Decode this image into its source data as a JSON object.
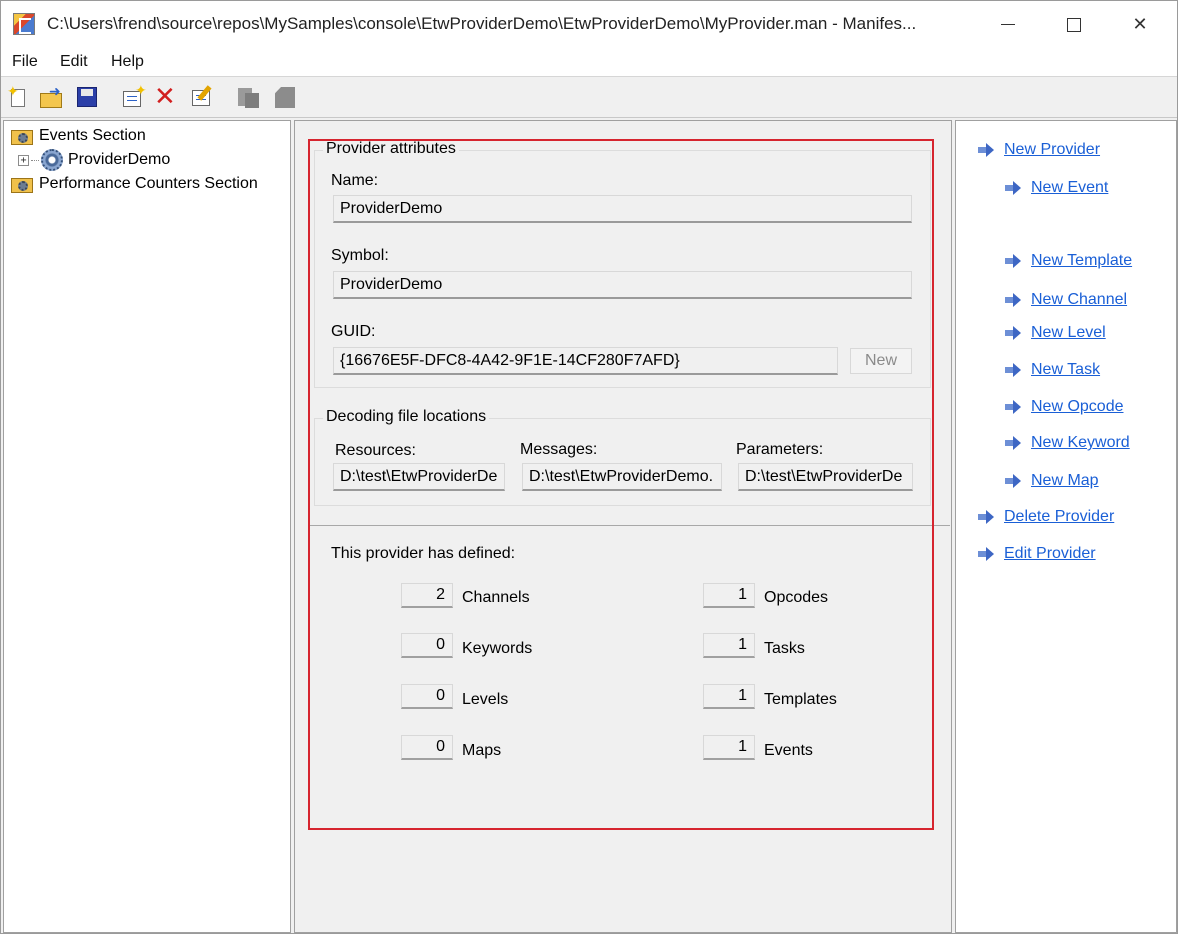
{
  "window": {
    "title": "C:\\Users\\frend\\source\\repos\\MySamples\\console\\EtwProviderDemo\\EtwProviderDemo\\MyProvider.man - Manifes...",
    "minimize_icon": "minimize-icon",
    "maximize_icon": "maximize-icon",
    "close_glyph": "✕"
  },
  "menu": {
    "items": [
      "File",
      "Edit",
      "Help"
    ]
  },
  "toolbar": {
    "icons": [
      "new-file-icon",
      "open-folder-icon",
      "save-icon",
      "new-item-icon",
      "delete-icon",
      "edit-icon",
      "copy-icon",
      "paste-icon"
    ],
    "delete_glyph": "✕",
    "star_glyph": "✦"
  },
  "tree": {
    "items": [
      {
        "label": "Events Section",
        "icon": "folder-gear-icon"
      },
      {
        "label": "ProviderDemo",
        "icon": "gear-icon",
        "expander": "+"
      },
      {
        "label": "Performance Counters Section",
        "icon": "folder-gear-icon"
      }
    ]
  },
  "provider": {
    "attributes_title": "Provider attributes",
    "name_label": "Name:",
    "name_value": "ProviderDemo",
    "symbol_label": "Symbol:",
    "symbol_value": "ProviderDemo",
    "guid_label": "GUID:",
    "guid_value": "{16676E5F-DFC8-4A42-9F1E-14CF280F7AFD}",
    "new_button": "New"
  },
  "decoding": {
    "title": "Decoding file locations",
    "resources_label": "Resources:",
    "resources_value": "D:\\test\\EtwProviderDe",
    "messages_label": "Messages:",
    "messages_value": "D:\\test\\EtwProviderDemo.",
    "parameters_label": "Parameters:",
    "parameters_value": "D:\\test\\EtwProviderDe"
  },
  "summary": {
    "heading": "This provider has defined:",
    "left": [
      {
        "count": "2",
        "label": "Channels"
      },
      {
        "count": "0",
        "label": "Keywords"
      },
      {
        "count": "0",
        "label": "Levels"
      },
      {
        "count": "0",
        "label": "Maps"
      }
    ],
    "right": [
      {
        "count": "1",
        "label": "Opcodes"
      },
      {
        "count": "1",
        "label": "Tasks"
      },
      {
        "count": "1",
        "label": "Templates"
      },
      {
        "count": "1",
        "label": "Events"
      }
    ]
  },
  "actions": {
    "items": [
      {
        "label": "New Provider"
      },
      {
        "label": "New Event"
      },
      {
        "label": "New Template"
      },
      {
        "label": "New Channel"
      },
      {
        "label": "New Level"
      },
      {
        "label": "New Task"
      },
      {
        "label": "New Opcode"
      },
      {
        "label": "New Keyword"
      },
      {
        "label": "New Map"
      },
      {
        "label": "Delete Provider"
      },
      {
        "label": "Edit Provider"
      }
    ]
  },
  "colors": {
    "highlight": "#d6252f",
    "link": "#1a5fd6"
  }
}
